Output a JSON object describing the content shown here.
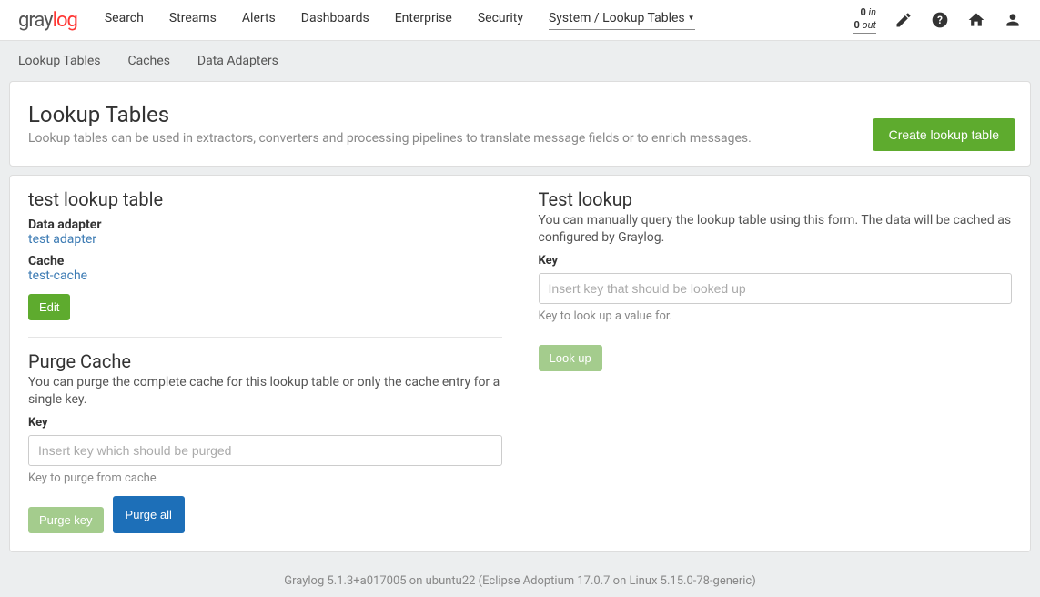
{
  "brand": {
    "part1": "gray",
    "part2": "log"
  },
  "nav": {
    "search": "Search",
    "streams": "Streams",
    "alerts": "Alerts",
    "dashboards": "Dashboards",
    "enterprise": "Enterprise",
    "security": "Security",
    "system": "System / Lookup Tables"
  },
  "io": {
    "in_val": "0",
    "in_lbl": "in",
    "out_val": "0",
    "out_lbl": "out"
  },
  "subnav": {
    "lookup": "Lookup Tables",
    "caches": "Caches",
    "adapters": "Data Adapters"
  },
  "header": {
    "title": "Lookup Tables",
    "desc": "Lookup tables can be used in extractors, converters and processing pipelines to translate message fields or to enrich messages.",
    "create": "Create lookup table"
  },
  "detail": {
    "name": "test lookup table",
    "adapter_label": "Data adapter",
    "adapter_value": "test adapter",
    "cache_label": "Cache",
    "cache_value": "test-cache",
    "edit": "Edit"
  },
  "purge": {
    "title": "Purge Cache",
    "desc": "You can purge the complete cache for this lookup table or only the cache entry for a single key.",
    "key_label": "Key",
    "placeholder": "Insert key which should be purged",
    "hint": "Key to purge from cache",
    "purge_key": "Purge key",
    "purge_all": "Purge all"
  },
  "test": {
    "title": "Test lookup",
    "desc": "You can manually query the lookup table using this form. The data will be cached as configured by Graylog.",
    "key_label": "Key",
    "placeholder": "Insert key that should be looked up",
    "hint": "Key to look up a value for.",
    "lookup": "Look up"
  },
  "footer": "Graylog 5.1.3+a017005 on ubuntu22 (Eclipse Adoptium 17.0.7 on Linux 5.15.0-78-generic)"
}
